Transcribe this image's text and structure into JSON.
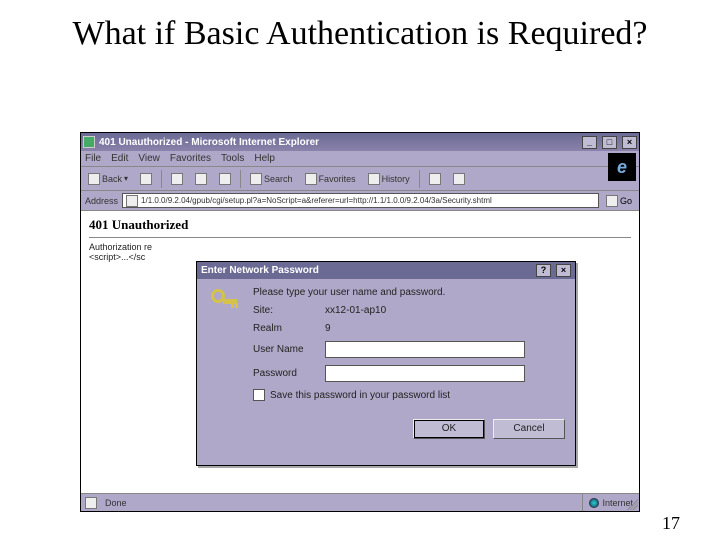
{
  "slide": {
    "title": "What if Basic Authentication is Required?",
    "page_number": "17"
  },
  "browser": {
    "title": "401 Unauthorized - Microsoft Internet Explorer",
    "menu": {
      "file": "File",
      "edit": "Edit",
      "view": "View",
      "favorites": "Favorites",
      "tools": "Tools",
      "help": "Help"
    },
    "toolbar": {
      "back": "Back",
      "search": "Search",
      "favorites": "Favorites",
      "history": "History"
    },
    "address_label": "Address",
    "url": "1/1.0.0/9.2.04/gpub/cgi/setup.pl?a=NoScript=a&referer=url=http://1.1/1.0.0/9.2.04/3a/Security.shtml",
    "go_label": "Go",
    "page_heading": "401 Unauthorized",
    "auth_line_1": "Authorization re",
    "auth_line_2": "<script>...</sc",
    "status_done": "Done",
    "zone": "Internet"
  },
  "dialog": {
    "title": "Enter Network Password",
    "message": "Please type your user name and password.",
    "site_label": "Site:",
    "site_value": "xx12-01-ap10",
    "realm_label": "Realm",
    "realm_value": "9",
    "username_label": "User Name",
    "password_label": "Password",
    "save_label": "Save this password in your password list",
    "ok_label": "OK",
    "cancel_label": "Cancel"
  }
}
